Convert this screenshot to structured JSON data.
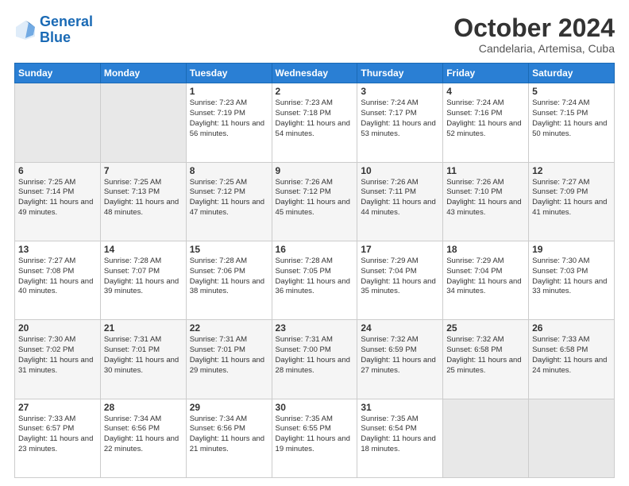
{
  "logo": {
    "line1": "General",
    "line2": "Blue"
  },
  "header": {
    "month": "October 2024",
    "location": "Candelaria, Artemisa, Cuba"
  },
  "weekdays": [
    "Sunday",
    "Monday",
    "Tuesday",
    "Wednesday",
    "Thursday",
    "Friday",
    "Saturday"
  ],
  "weeks": [
    [
      {
        "day": "",
        "sunrise": "",
        "sunset": "",
        "daylight": ""
      },
      {
        "day": "",
        "sunrise": "",
        "sunset": "",
        "daylight": ""
      },
      {
        "day": "1",
        "sunrise": "Sunrise: 7:23 AM",
        "sunset": "Sunset: 7:19 PM",
        "daylight": "Daylight: 11 hours and 56 minutes."
      },
      {
        "day": "2",
        "sunrise": "Sunrise: 7:23 AM",
        "sunset": "Sunset: 7:18 PM",
        "daylight": "Daylight: 11 hours and 54 minutes."
      },
      {
        "day": "3",
        "sunrise": "Sunrise: 7:24 AM",
        "sunset": "Sunset: 7:17 PM",
        "daylight": "Daylight: 11 hours and 53 minutes."
      },
      {
        "day": "4",
        "sunrise": "Sunrise: 7:24 AM",
        "sunset": "Sunset: 7:16 PM",
        "daylight": "Daylight: 11 hours and 52 minutes."
      },
      {
        "day": "5",
        "sunrise": "Sunrise: 7:24 AM",
        "sunset": "Sunset: 7:15 PM",
        "daylight": "Daylight: 11 hours and 50 minutes."
      }
    ],
    [
      {
        "day": "6",
        "sunrise": "Sunrise: 7:25 AM",
        "sunset": "Sunset: 7:14 PM",
        "daylight": "Daylight: 11 hours and 49 minutes."
      },
      {
        "day": "7",
        "sunrise": "Sunrise: 7:25 AM",
        "sunset": "Sunset: 7:13 PM",
        "daylight": "Daylight: 11 hours and 48 minutes."
      },
      {
        "day": "8",
        "sunrise": "Sunrise: 7:25 AM",
        "sunset": "Sunset: 7:12 PM",
        "daylight": "Daylight: 11 hours and 47 minutes."
      },
      {
        "day": "9",
        "sunrise": "Sunrise: 7:26 AM",
        "sunset": "Sunset: 7:12 PM",
        "daylight": "Daylight: 11 hours and 45 minutes."
      },
      {
        "day": "10",
        "sunrise": "Sunrise: 7:26 AM",
        "sunset": "Sunset: 7:11 PM",
        "daylight": "Daylight: 11 hours and 44 minutes."
      },
      {
        "day": "11",
        "sunrise": "Sunrise: 7:26 AM",
        "sunset": "Sunset: 7:10 PM",
        "daylight": "Daylight: 11 hours and 43 minutes."
      },
      {
        "day": "12",
        "sunrise": "Sunrise: 7:27 AM",
        "sunset": "Sunset: 7:09 PM",
        "daylight": "Daylight: 11 hours and 41 minutes."
      }
    ],
    [
      {
        "day": "13",
        "sunrise": "Sunrise: 7:27 AM",
        "sunset": "Sunset: 7:08 PM",
        "daylight": "Daylight: 11 hours and 40 minutes."
      },
      {
        "day": "14",
        "sunrise": "Sunrise: 7:28 AM",
        "sunset": "Sunset: 7:07 PM",
        "daylight": "Daylight: 11 hours and 39 minutes."
      },
      {
        "day": "15",
        "sunrise": "Sunrise: 7:28 AM",
        "sunset": "Sunset: 7:06 PM",
        "daylight": "Daylight: 11 hours and 38 minutes."
      },
      {
        "day": "16",
        "sunrise": "Sunrise: 7:28 AM",
        "sunset": "Sunset: 7:05 PM",
        "daylight": "Daylight: 11 hours and 36 minutes."
      },
      {
        "day": "17",
        "sunrise": "Sunrise: 7:29 AM",
        "sunset": "Sunset: 7:04 PM",
        "daylight": "Daylight: 11 hours and 35 minutes."
      },
      {
        "day": "18",
        "sunrise": "Sunrise: 7:29 AM",
        "sunset": "Sunset: 7:04 PM",
        "daylight": "Daylight: 11 hours and 34 minutes."
      },
      {
        "day": "19",
        "sunrise": "Sunrise: 7:30 AM",
        "sunset": "Sunset: 7:03 PM",
        "daylight": "Daylight: 11 hours and 33 minutes."
      }
    ],
    [
      {
        "day": "20",
        "sunrise": "Sunrise: 7:30 AM",
        "sunset": "Sunset: 7:02 PM",
        "daylight": "Daylight: 11 hours and 31 minutes."
      },
      {
        "day": "21",
        "sunrise": "Sunrise: 7:31 AM",
        "sunset": "Sunset: 7:01 PM",
        "daylight": "Daylight: 11 hours and 30 minutes."
      },
      {
        "day": "22",
        "sunrise": "Sunrise: 7:31 AM",
        "sunset": "Sunset: 7:01 PM",
        "daylight": "Daylight: 11 hours and 29 minutes."
      },
      {
        "day": "23",
        "sunrise": "Sunrise: 7:31 AM",
        "sunset": "Sunset: 7:00 PM",
        "daylight": "Daylight: 11 hours and 28 minutes."
      },
      {
        "day": "24",
        "sunrise": "Sunrise: 7:32 AM",
        "sunset": "Sunset: 6:59 PM",
        "daylight": "Daylight: 11 hours and 27 minutes."
      },
      {
        "day": "25",
        "sunrise": "Sunrise: 7:32 AM",
        "sunset": "Sunset: 6:58 PM",
        "daylight": "Daylight: 11 hours and 25 minutes."
      },
      {
        "day": "26",
        "sunrise": "Sunrise: 7:33 AM",
        "sunset": "Sunset: 6:58 PM",
        "daylight": "Daylight: 11 hours and 24 minutes."
      }
    ],
    [
      {
        "day": "27",
        "sunrise": "Sunrise: 7:33 AM",
        "sunset": "Sunset: 6:57 PM",
        "daylight": "Daylight: 11 hours and 23 minutes."
      },
      {
        "day": "28",
        "sunrise": "Sunrise: 7:34 AM",
        "sunset": "Sunset: 6:56 PM",
        "daylight": "Daylight: 11 hours and 22 minutes."
      },
      {
        "day": "29",
        "sunrise": "Sunrise: 7:34 AM",
        "sunset": "Sunset: 6:56 PM",
        "daylight": "Daylight: 11 hours and 21 minutes."
      },
      {
        "day": "30",
        "sunrise": "Sunrise: 7:35 AM",
        "sunset": "Sunset: 6:55 PM",
        "daylight": "Daylight: 11 hours and 19 minutes."
      },
      {
        "day": "31",
        "sunrise": "Sunrise: 7:35 AM",
        "sunset": "Sunset: 6:54 PM",
        "daylight": "Daylight: 11 hours and 18 minutes."
      },
      {
        "day": "",
        "sunrise": "",
        "sunset": "",
        "daylight": ""
      },
      {
        "day": "",
        "sunrise": "",
        "sunset": "",
        "daylight": ""
      }
    ]
  ]
}
